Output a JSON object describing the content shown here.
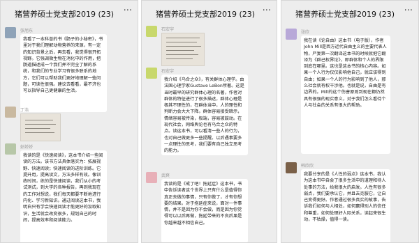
{
  "panels": [
    {
      "title": "猪营养硕士党支部2019 (23)",
      "more": "···",
      "messages": [
        {
          "name": "张旭东",
          "avatar_color": "#8fa3b8",
          "text": "我看了一本科普的书《肠子的小秘密》，书里对于我们理解动物营养的来源，有一定的知识背景之后，再去看，我觉得很开拓视野。它强调微生物在消化中的作用，把肠道描述成一个我们并不完全了解的系统，和我们的专业学习有很多联系的地方，它们可以帮助我们更好地理解一些问题，可读性很强。建议去看看，最不济也可以指导自己更健康的生活。"
        },
        {
          "name": "丁浩",
          "avatar_color": "#c9b9a0",
          "text": ""
        },
        {
          "name": "彭娇娇",
          "avatar_color": "#b7c7a8",
          "text": "我读的是《快速阅读》，这本书介绍一些阅读的方法。该书方法具体落实为：拓展视野、快速阅读；快速阅读的进阶训练。它提升用，提高读文，方法多样有效。像训练时间，练的是快速阅读，我们从小的考试测试，到大学的各种报告，再到我现在的工作对想说，我们每天都要不断地进行内化、学习新知识。通过阅读这本书，我明白只有学会快速阅读才能更好的汲取知识，生活就会改变很多，规划自己的时间，提高效率和阅读能力。"
        }
      ]
    },
    {
      "title": "猪营养硕士党支部2019 (23)",
      "more": "···",
      "messages": [
        {
          "name": "石宏宇",
          "avatar_color": "#c8d86c",
          "text": ""
        },
        {
          "name": "石宏宇",
          "avatar_color": "#c8d86c",
          "text": "我介绍《乌合之众》，有关群体心理学。由法国心理学家Gustave LeBon所著。这是当时最早的研究群体心理的名著，作者对群体的特征进行了很多描述，群体心理是极其不理性的，在群体当中，人的理性和判断力会大大下降。群体容易接受暗示，情绪容易被传染，极端，容易被鼓动。在现代社会，网络舆论也有乌合之众的特点。读这本书，可以看清一些人的行为，也对自己做更多一些提醒。以后遇事要多一点理性的思考，我们要有自己独立思考的能力。"
        },
        {
          "name": "武爽",
          "avatar_color": "#e8b0b8",
          "text": "我读的是《戒了吧！拖延症》这本书，书中告诉读者这个世界上只有什么是值得你真正去做的事情，只有你做了，才有你想要的结果。对于拖延症来说，面对一件事情，并不是因为你不会做，而是因为你觉得可以以后再做，拖延带来的不良后果是你越来越不相信自己。"
        }
      ]
    },
    {
      "title": "猪营养硕士党支部2019 (23)",
      "more": "···",
      "messages": [
        {
          "name": "张欣",
          "avatar_color": "#b8a8d8",
          "text": "我在读《论自由》这本书（电子版），作者John Mill是西方近代自由主义的主要代表人物，严复第一次翻译这本书的时候就把它翻译为《群己权界论》，即群体和个人的界限到底在哪里。这也是这本书的核心内容。如果一个人行为仅仅影响他自己，就应该得到自由；如果一个人的行为影响到了他人，那么社会就有权干涉他。也就是说，自由是有边界的。Mill的这个伤害原则到现在都仍然具有很强的现实意义，对于我们怎么看待个人与社会的关系有很大的帮助。"
        },
        {
          "name": "韩欣欣",
          "avatar_color": "#7a6048",
          "text": "我要分享的是《人性的弱点》这本书，我认为这本书中自会了很多生活中的道理和待人处事的方法，给我很大的启发。人性有很多弱点，我们要承认它，并且去克服它，让自己变得更好。作者通过很多真实的故事，告诉我们如何与人相处，如何赢得别人的信任和尊重，如何处理好人际关系，读起来很生动，不枯燥，值得一读。"
        }
      ]
    }
  ]
}
